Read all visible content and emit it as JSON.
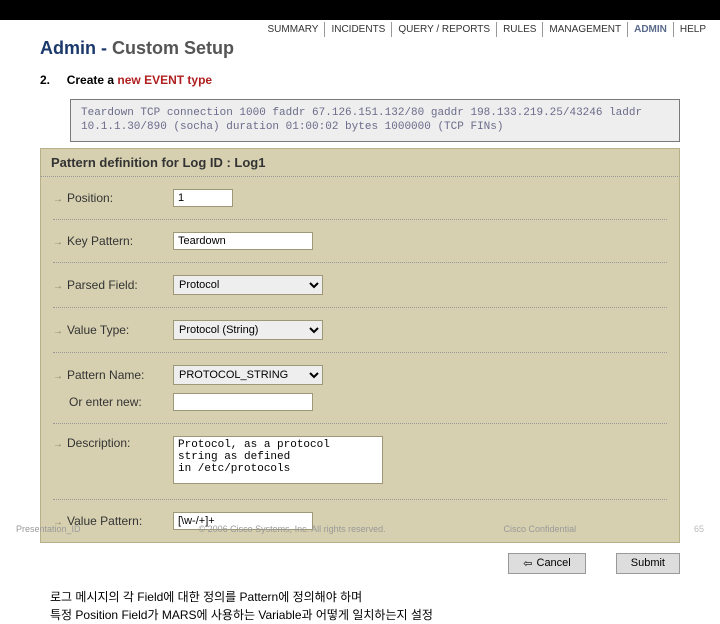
{
  "nav": {
    "items": [
      "SUMMARY",
      "INCIDENTS",
      "QUERY / REPORTS",
      "RULES",
      "MANAGEMENT",
      "ADMIN",
      "HELP"
    ]
  },
  "title": {
    "prefix": "Admin - ",
    "suffix": "Custom Setup"
  },
  "step": {
    "num": "2.",
    "label": "Create a ",
    "red": "new EVENT type"
  },
  "logbox": "Teardown TCP connection 1000 faddr 67.126.151.132/80 gaddr 198.133.219.25/43246 laddr 10.1.1.30/890 (socha) duration 01:00:02 bytes 1000000 (TCP FINs)",
  "pattern_header": "Pattern definition for Log ID : Log1",
  "fields": {
    "position": {
      "label": "Position:",
      "value": "1"
    },
    "keypat": {
      "label": "Key Pattern:",
      "value": "Teardown"
    },
    "parsed": {
      "label": "Parsed Field:",
      "value": "Protocol"
    },
    "vtype": {
      "label": "Value Type:",
      "value": "Protocol (String)"
    },
    "pname": {
      "label": "Pattern Name:",
      "value": "PROTOCOL_STRING"
    },
    "enter": {
      "label": "Or enter new:",
      "value": ""
    },
    "descr": {
      "label": "Description:",
      "value": "Protocol, as a protocol\nstring as defined\nin /etc/protocols"
    },
    "vpat": {
      "label": "Value Pattern:",
      "value": "[\\w-/+]+"
    }
  },
  "buttons": {
    "cancel": "Cancel",
    "submit": "Submit"
  },
  "description": {
    "l1": "로그 메시지의 각 Field에 대한 정의를 Pattern에 정의해야 하며",
    "l2": "특정 Position Field가 MARS에 사용하는 Variable과 어떻게 일치하는지 설정"
  },
  "footer": {
    "left": "Presentation_ID",
    "mid": "© 2006 Cisco Systems, Inc. All rights reserved.",
    "mid2": "Cisco Confidential",
    "right": "65"
  }
}
